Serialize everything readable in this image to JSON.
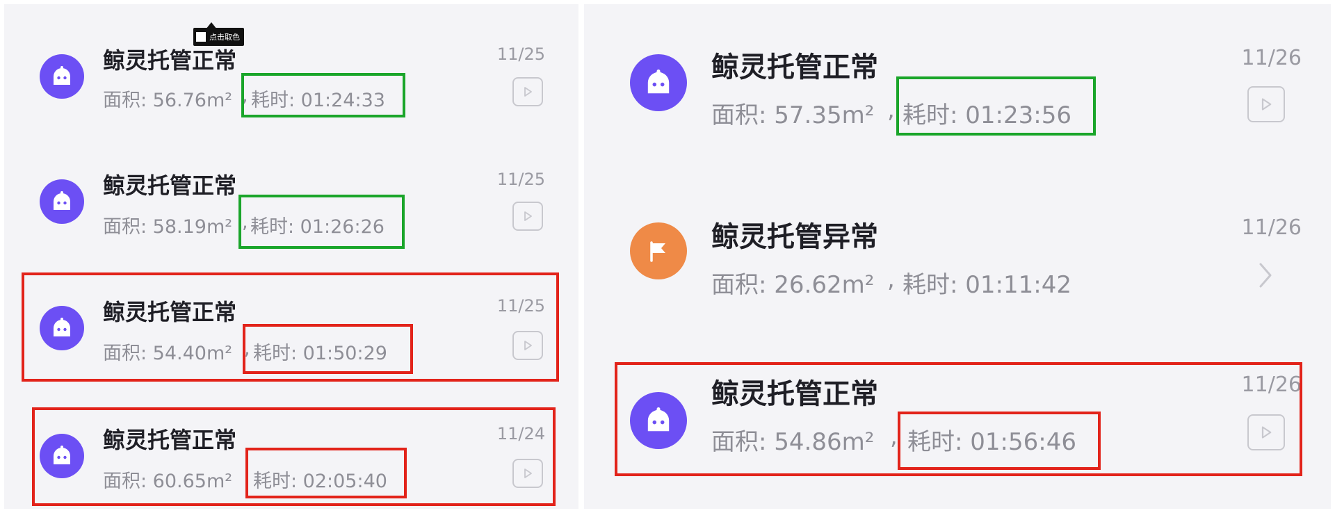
{
  "colors": {
    "normal_avatar": "#6c4ff4",
    "error_avatar": "#ef8a47",
    "highlight_green": "#1aa52a",
    "highlight_red": "#e2231a",
    "background": "#f4f4f7"
  },
  "tooltip": {
    "label": "点击取色"
  },
  "left": {
    "records": [
      {
        "title": "鲸灵托管正常",
        "area": "面积: 56.76m²",
        "sep": ",",
        "duration": "耗时: 01:24:33",
        "date": "11/25",
        "status": "normal",
        "icon": "robot-icon",
        "action_icon": "play-icon"
      },
      {
        "title": "鲸灵托管正常",
        "area": "面积: 58.19m²",
        "sep": ",",
        "duration": "耗时: 01:26:26",
        "date": "11/25",
        "status": "normal",
        "icon": "robot-icon",
        "action_icon": "play-icon"
      },
      {
        "title": "鲸灵托管正常",
        "area": "面积: 54.40m²",
        "sep": ",",
        "duration": "耗时: 01:50:29",
        "date": "11/25",
        "status": "normal",
        "icon": "robot-icon",
        "action_icon": "play-icon"
      },
      {
        "title": "鲸灵托管正常",
        "area": "面积: 60.65m²",
        "sep": ",",
        "duration": "耗时: 02:05:40",
        "date": "11/24",
        "status": "normal",
        "icon": "robot-icon",
        "action_icon": "play-icon"
      }
    ]
  },
  "right": {
    "records": [
      {
        "title": "鲸灵托管正常",
        "area": "面积: 57.35m²",
        "sep": ",",
        "duration": "耗时: 01:23:56",
        "date": "11/26",
        "status": "normal",
        "icon": "robot-icon",
        "action_icon": "play-icon"
      },
      {
        "title": "鲸灵托管异常",
        "area": "面积: 26.62m²",
        "sep": ",",
        "duration": "耗时: 01:11:42",
        "date": "11/26",
        "status": "error",
        "icon": "flag-icon",
        "action_icon": "chevron-right-icon"
      },
      {
        "title": "鲸灵托管正常",
        "area": "面积: 54.86m²",
        "sep": ",",
        "duration": "耗时: 01:56:46",
        "date": "11/26",
        "status": "normal",
        "icon": "robot-icon",
        "action_icon": "play-icon"
      }
    ]
  }
}
